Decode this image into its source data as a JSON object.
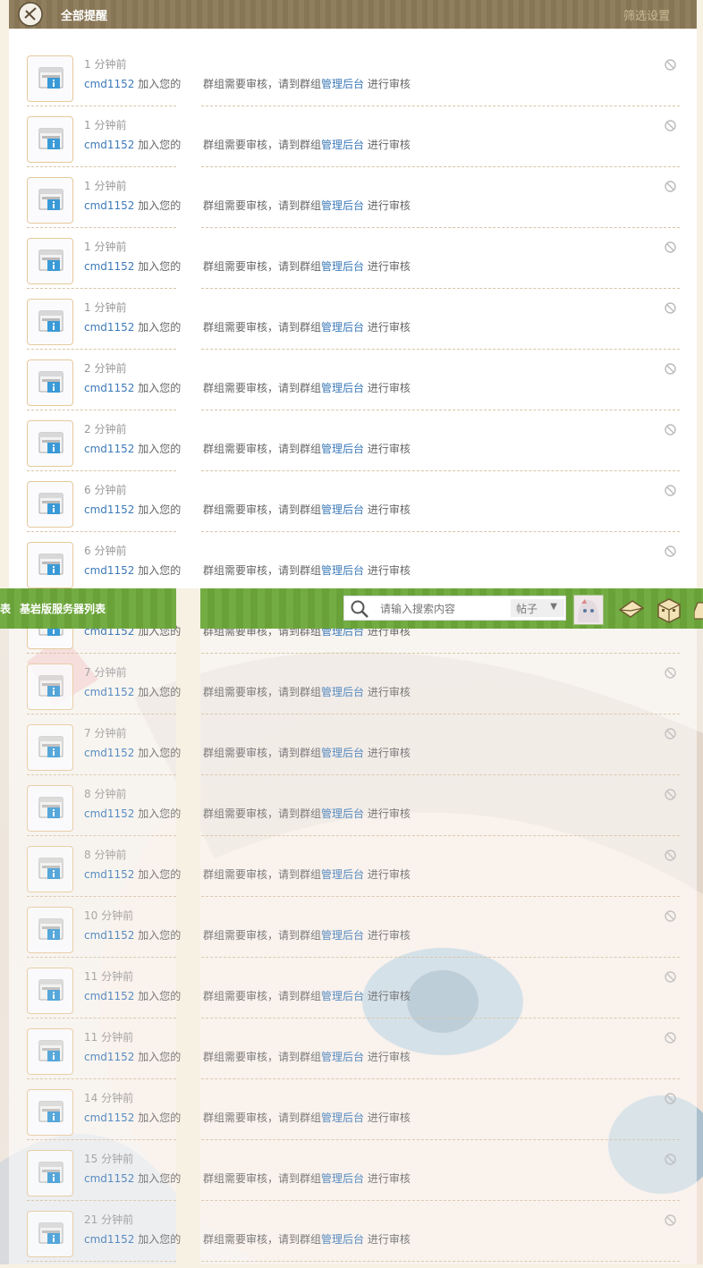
{
  "header": {
    "title": "全部提醒",
    "filter_label": "筛选设置"
  },
  "navbar": {
    "left_cut": "表",
    "link": "基岩版服务器列表",
    "search_placeholder": "请输入搜索内容",
    "search_type": "帖子"
  },
  "notifications": [
    {
      "time": "1 分钟前",
      "user": "cmd1152",
      "join": " 加入您的",
      "msg_pre": "群组需要审核，请到群组",
      "msg_link": "管理后台",
      "msg_post": " 进行审核"
    },
    {
      "time": "1 分钟前",
      "user": "cmd1152",
      "join": " 加入您的",
      "msg_pre": "群组需要审核，请到群组",
      "msg_link": "管理后台",
      "msg_post": " 进行审核"
    },
    {
      "time": "1 分钟前",
      "user": "cmd1152",
      "join": " 加入您的",
      "msg_pre": "群组需要审核，请到群组",
      "msg_link": "管理后台",
      "msg_post": " 进行审核"
    },
    {
      "time": "1 分钟前",
      "user": "cmd1152",
      "join": " 加入您的",
      "msg_pre": "群组需要审核，请到群组",
      "msg_link": "管理后台",
      "msg_post": " 进行审核"
    },
    {
      "time": "1 分钟前",
      "user": "cmd1152",
      "join": " 加入您的",
      "msg_pre": "群组需要审核，请到群组",
      "msg_link": "管理后台",
      "msg_post": " 进行审核"
    },
    {
      "time": "2 分钟前",
      "user": "cmd1152",
      "join": " 加入您的",
      "msg_pre": "群组需要审核，请到群组",
      "msg_link": "管理后台",
      "msg_post": " 进行审核"
    },
    {
      "time": "2 分钟前",
      "user": "cmd1152",
      "join": " 加入您的",
      "msg_pre": "群组需要审核，请到群组",
      "msg_link": "管理后台",
      "msg_post": " 进行审核"
    },
    {
      "time": "6 分钟前",
      "user": "cmd1152",
      "join": " 加入您的",
      "msg_pre": "群组需要审核，请到群组",
      "msg_link": "管理后台",
      "msg_post": " 进行审核"
    },
    {
      "time": "6 分钟前",
      "user": "cmd1152",
      "join": " 加入您的",
      "msg_pre": "群组需要审核，请到群组",
      "msg_link": "管理后台",
      "msg_post": " 进行审核"
    },
    {
      "time": "",
      "user": "cmd1152",
      "join": " 加入您的",
      "msg_pre": "群组需要审核，请到群组",
      "msg_link": "管理后台",
      "msg_post": " 进行审核"
    },
    {
      "time": "7 分钟前",
      "user": "cmd1152",
      "join": " 加入您的",
      "msg_pre": "群组需要审核，请到群组",
      "msg_link": "管理后台",
      "msg_post": " 进行审核"
    },
    {
      "time": "7 分钟前",
      "user": "cmd1152",
      "join": " 加入您的",
      "msg_pre": "群组需要审核，请到群组",
      "msg_link": "管理后台",
      "msg_post": " 进行审核"
    },
    {
      "time": "8 分钟前",
      "user": "cmd1152",
      "join": " 加入您的",
      "msg_pre": "群组需要审核，请到群组",
      "msg_link": "管理后台",
      "msg_post": " 进行审核"
    },
    {
      "time": "8 分钟前",
      "user": "cmd1152",
      "join": " 加入您的",
      "msg_pre": "群组需要审核，请到群组",
      "msg_link": "管理后台",
      "msg_post": " 进行审核"
    },
    {
      "time": "10 分钟前",
      "user": "cmd1152",
      "join": " 加入您的",
      "msg_pre": "群组需要审核，请到群组",
      "msg_link": "管理后台",
      "msg_post": " 进行审核"
    },
    {
      "time": "11 分钟前",
      "user": "cmd1152",
      "join": " 加入您的",
      "msg_pre": "群组需要审核，请到群组",
      "msg_link": "管理后台",
      "msg_post": " 进行审核"
    },
    {
      "time": "11 分钟前",
      "user": "cmd1152",
      "join": " 加入您的",
      "msg_pre": "群组需要审核，请到群组",
      "msg_link": "管理后台",
      "msg_post": " 进行审核"
    },
    {
      "time": "14 分钟前",
      "user": "cmd1152",
      "join": " 加入您的",
      "msg_pre": "群组需要审核，请到群组",
      "msg_link": "管理后台",
      "msg_post": " 进行审核"
    },
    {
      "time": "15 分钟前",
      "user": "cmd1152",
      "join": " 加入您的",
      "msg_pre": "群组需要审核，请到群组",
      "msg_link": "管理后台",
      "msg_post": " 进行审核"
    },
    {
      "time": "21 分钟前",
      "user": "cmd1152",
      "join": " 加入您的",
      "msg_pre": "群组需要审核，请到群组",
      "msg_link": "管理后台",
      "msg_post": " 进行审核"
    }
  ]
}
